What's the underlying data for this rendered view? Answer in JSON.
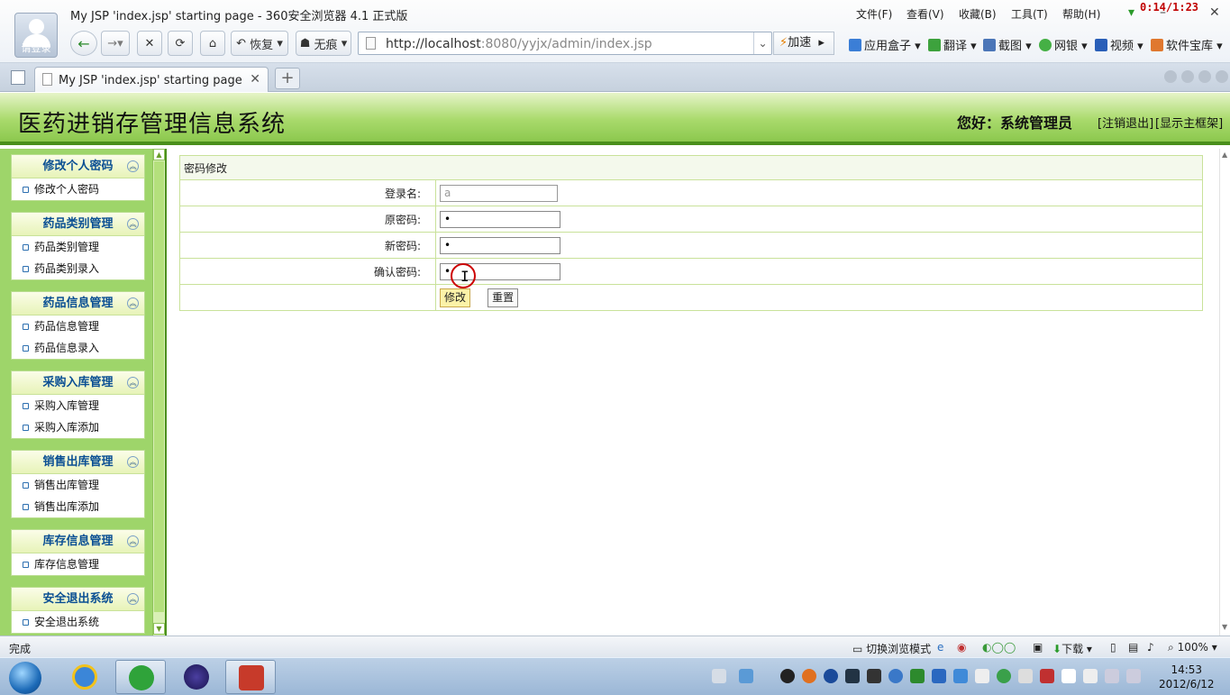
{
  "browser": {
    "window_title": "My JSP 'index.jsp' starting page - 360安全浏览器 4.1 正式版",
    "login_label": "请登录",
    "menus": [
      "文件(F)",
      "查看(V)",
      "收藏(B)",
      "工具(T)",
      "帮助(H)"
    ],
    "recording_timer": "0:14/1:23",
    "restore_label": "恢复",
    "notrace_label": "无痕",
    "url_host": "http://localhost",
    "url_path": ":8080/yyjx/admin/index.jsp",
    "speed_label": "加速",
    "toolbar_items": [
      "应用盒子",
      "翻译",
      "截图",
      "网银",
      "视频",
      "软件宝库"
    ],
    "tab_title": "My JSP 'index.jsp' starting page"
  },
  "app": {
    "title": "医药进销存管理信息系统",
    "greeting": "您好：系统管理员",
    "logout": "[注销退出]",
    "show_main_frame": "[显示主框架]"
  },
  "sidebar": {
    "groups": [
      {
        "title": "修改个人密码",
        "items": [
          "修改个人密码"
        ]
      },
      {
        "title": "药品类别管理",
        "items": [
          "药品类别管理",
          "药品类别录入"
        ]
      },
      {
        "title": "药品信息管理",
        "items": [
          "药品信息管理",
          "药品信息录入"
        ]
      },
      {
        "title": "采购入库管理",
        "items": [
          "采购入库管理",
          "采购入库添加"
        ]
      },
      {
        "title": "销售出库管理",
        "items": [
          "销售出库管理",
          "销售出库添加"
        ]
      },
      {
        "title": "库存信息管理",
        "items": [
          "库存信息管理"
        ]
      },
      {
        "title": "安全退出系统",
        "items": [
          "安全退出系统"
        ]
      }
    ]
  },
  "form": {
    "caption": "密码修改",
    "login_label": "登录名:",
    "login_value": "a",
    "old_label": "原密码:",
    "old_value": "•",
    "new_label": "新密码:",
    "new_value": "•",
    "confirm_label": "确认密码:",
    "confirm_value": "•",
    "submit_label": "修改",
    "reset_label": "重置"
  },
  "statusbar": {
    "status": "完成",
    "switch_mode": "切换浏览模式",
    "download": "下载",
    "zoom": "100%"
  },
  "taskbar": {
    "time": "14:53",
    "date": "2012/6/12"
  }
}
